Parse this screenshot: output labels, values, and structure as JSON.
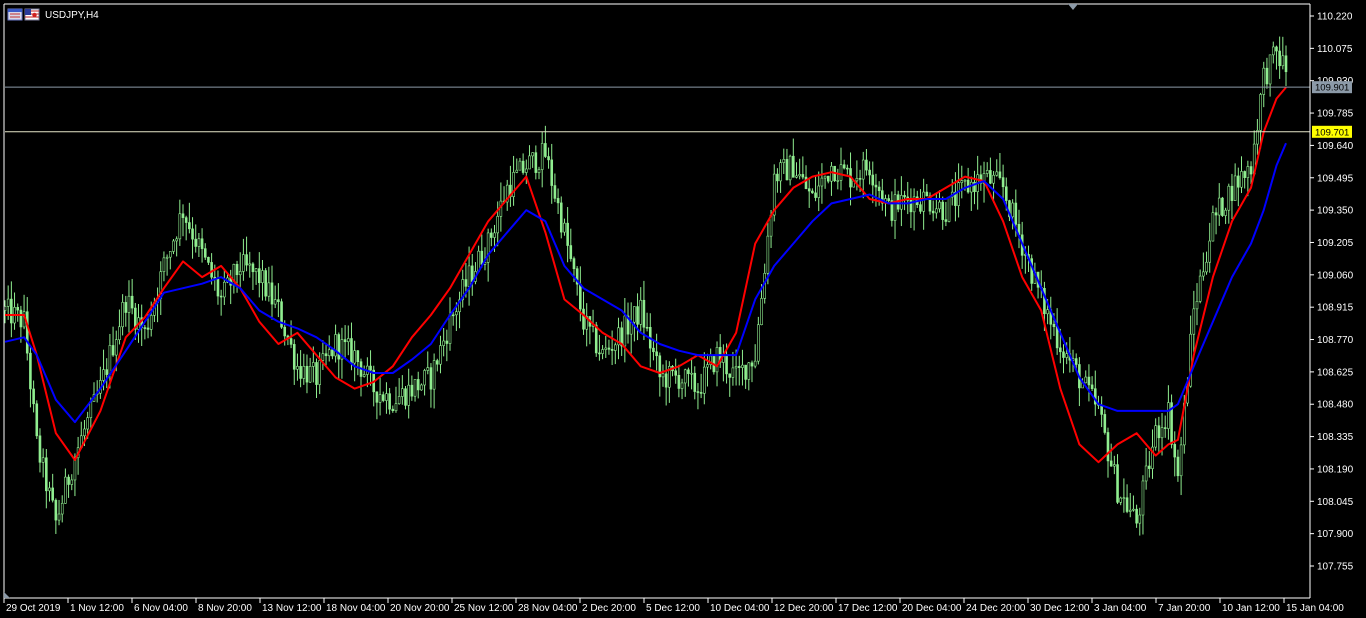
{
  "window": {
    "symbol_title": "USDJPY,H4"
  },
  "icons": {
    "window_icon": "window-icon",
    "flag_icon": "flag-icon"
  },
  "colors": {
    "background": "#000000",
    "axis": "#ffffff",
    "candles": "#90ee90",
    "ma_fast": "#ff0000",
    "ma_slow": "#0000ff",
    "bid_line": "#8c9aa8",
    "bid_tag": "#8c9aa8",
    "level_line": "#e6e6c8",
    "level_tag": "#ffff00"
  },
  "chart_data": {
    "type": "line",
    "title": "USDJPY,H4",
    "xlabel": "",
    "ylabel": "",
    "ylim": [
      107.63,
      110.25
    ],
    "grid": false,
    "y_ticks": [
      "110.220",
      "110.075",
      "109.930",
      "109.785",
      "109.640",
      "109.495",
      "109.350",
      "109.205",
      "109.060",
      "108.915",
      "108.770",
      "108.625",
      "108.480",
      "108.335",
      "108.190",
      "108.045",
      "107.900",
      "107.755"
    ],
    "x_ticks": [
      "29 Oct 2019",
      "1 Nov 12:00",
      "6 Nov 04:00",
      "8 Nov 20:00",
      "13 Nov 12:00",
      "18 Nov 04:00",
      "20 Nov 20:00",
      "25 Nov 12:00",
      "28 Nov 04:00",
      "2 Dec 20:00",
      "5 Dec 12:00",
      "10 Dec 04:00",
      "12 Dec 20:00",
      "17 Dec 12:00",
      "20 Dec 04:00",
      "24 Dec 20:00",
      "30 Dec 12:00",
      "3 Jan 04:00",
      "7 Jan 20:00",
      "10 Jan 12:00",
      "15 Jan 04:00"
    ],
    "price_levels": [
      {
        "label": "109.901",
        "value": 109.901,
        "kind": "bid"
      },
      {
        "label": "109.701",
        "value": 109.701,
        "kind": "level"
      }
    ],
    "candle_keypoints": [
      [
        0,
        108.9
      ],
      [
        6,
        108.85
      ],
      [
        10,
        108.3
      ],
      [
        16,
        107.95
      ],
      [
        22,
        108.25
      ],
      [
        30,
        108.55
      ],
      [
        38,
        108.95
      ],
      [
        44,
        108.8
      ],
      [
        50,
        109.1
      ],
      [
        56,
        109.35
      ],
      [
        62,
        109.15
      ],
      [
        68,
        108.95
      ],
      [
        74,
        109.1
      ],
      [
        80,
        109.05
      ],
      [
        86,
        108.9
      ],
      [
        92,
        108.65
      ],
      [
        98,
        108.6
      ],
      [
        104,
        108.75
      ],
      [
        110,
        108.7
      ],
      [
        116,
        108.55
      ],
      [
        122,
        108.5
      ],
      [
        128,
        108.55
      ],
      [
        134,
        108.6
      ],
      [
        140,
        108.85
      ],
      [
        146,
        109.05
      ],
      [
        152,
        109.2
      ],
      [
        158,
        109.45
      ],
      [
        164,
        109.55
      ],
      [
        170,
        109.6
      ],
      [
        176,
        109.25
      ],
      [
        182,
        108.85
      ],
      [
        188,
        108.7
      ],
      [
        194,
        108.8
      ],
      [
        200,
        108.9
      ],
      [
        206,
        108.6
      ],
      [
        212,
        108.6
      ],
      [
        218,
        108.55
      ],
      [
        224,
        108.7
      ],
      [
        230,
        108.6
      ],
      [
        236,
        108.7
      ],
      [
        242,
        109.5
      ],
      [
        248,
        109.55
      ],
      [
        254,
        109.4
      ],
      [
        260,
        109.55
      ],
      [
        266,
        109.5
      ],
      [
        272,
        109.55
      ],
      [
        278,
        109.35
      ],
      [
        284,
        109.4
      ],
      [
        290,
        109.4
      ],
      [
        296,
        109.35
      ],
      [
        302,
        109.45
      ],
      [
        308,
        109.5
      ],
      [
        314,
        109.45
      ],
      [
        320,
        109.2
      ],
      [
        326,
        108.95
      ],
      [
        332,
        108.75
      ],
      [
        338,
        108.6
      ],
      [
        344,
        108.45
      ],
      [
        350,
        108.1
      ],
      [
        356,
        107.95
      ],
      [
        362,
        108.35
      ],
      [
        366,
        108.45
      ],
      [
        369,
        108.15
      ],
      [
        374,
        108.9
      ],
      [
        380,
        109.3
      ],
      [
        386,
        109.45
      ],
      [
        392,
        109.55
      ],
      [
        396,
        109.95
      ],
      [
        400,
        110.05
      ],
      [
        403,
        109.98
      ]
    ],
    "series": [
      {
        "key": "ma_fast",
        "x": [
          0,
          6,
          10,
          16,
          22,
          30,
          38,
          44,
          50,
          56,
          62,
          68,
          74,
          80,
          86,
          92,
          98,
          104,
          110,
          116,
          122,
          128,
          134,
          140,
          146,
          152,
          158,
          164,
          170,
          176,
          182,
          188,
          194,
          200,
          206,
          212,
          218,
          224,
          230,
          236,
          242,
          248,
          254,
          260,
          266,
          272,
          278,
          284,
          290,
          296,
          302,
          308,
          314,
          320,
          326,
          332,
          338,
          344,
          350,
          356,
          362,
          366,
          369,
          374,
          380,
          386,
          392,
          396,
          400,
          403
        ],
        "values": [
          108.88,
          108.88,
          108.7,
          108.35,
          108.23,
          108.45,
          108.78,
          108.87,
          109.0,
          109.12,
          109.05,
          109.1,
          109.0,
          108.85,
          108.75,
          108.8,
          108.7,
          108.6,
          108.55,
          108.58,
          108.65,
          108.78,
          108.88,
          109.0,
          109.15,
          109.3,
          109.4,
          109.5,
          109.25,
          108.95,
          108.88,
          108.8,
          108.75,
          108.65,
          108.62,
          108.65,
          108.7,
          108.65,
          108.8,
          109.2,
          109.35,
          109.45,
          109.5,
          109.52,
          109.5,
          109.4,
          109.38,
          109.4,
          109.4,
          109.45,
          109.5,
          109.48,
          109.3,
          109.05,
          108.9,
          108.55,
          108.3,
          108.22,
          108.3,
          108.35,
          108.25,
          108.3,
          108.32,
          108.7,
          109.05,
          109.3,
          109.45,
          109.7,
          109.85,
          109.9
        ]
      },
      {
        "key": "ma_slow",
        "x": [
          0,
          6,
          10,
          16,
          22,
          30,
          38,
          44,
          50,
          56,
          62,
          68,
          74,
          80,
          86,
          92,
          98,
          104,
          110,
          116,
          122,
          128,
          134,
          140,
          146,
          152,
          158,
          164,
          170,
          176,
          182,
          188,
          194,
          200,
          206,
          212,
          218,
          224,
          230,
          236,
          242,
          248,
          254,
          260,
          266,
          272,
          278,
          284,
          290,
          296,
          302,
          308,
          314,
          320,
          326,
          332,
          338,
          344,
          350,
          356,
          362,
          366,
          369,
          374,
          380,
          386,
          392,
          396,
          400,
          403
        ],
        "values": [
          108.76,
          108.78,
          108.7,
          108.5,
          108.4,
          108.55,
          108.72,
          108.85,
          108.98,
          109.0,
          109.02,
          109.05,
          109.0,
          108.9,
          108.85,
          108.82,
          108.78,
          108.72,
          108.65,
          108.62,
          108.62,
          108.68,
          108.75,
          108.88,
          109.0,
          109.15,
          109.25,
          109.35,
          109.3,
          109.1,
          109.0,
          108.95,
          108.9,
          108.8,
          108.75,
          108.72,
          108.7,
          108.7,
          108.7,
          108.95,
          109.1,
          109.2,
          109.3,
          109.38,
          109.4,
          109.42,
          109.38,
          109.38,
          109.4,
          109.4,
          109.45,
          109.48,
          109.4,
          109.2,
          109.0,
          108.8,
          108.6,
          108.48,
          108.45,
          108.45,
          108.45,
          108.45,
          108.48,
          108.65,
          108.85,
          109.05,
          109.2,
          109.35,
          109.55,
          109.65
        ]
      }
    ]
  }
}
